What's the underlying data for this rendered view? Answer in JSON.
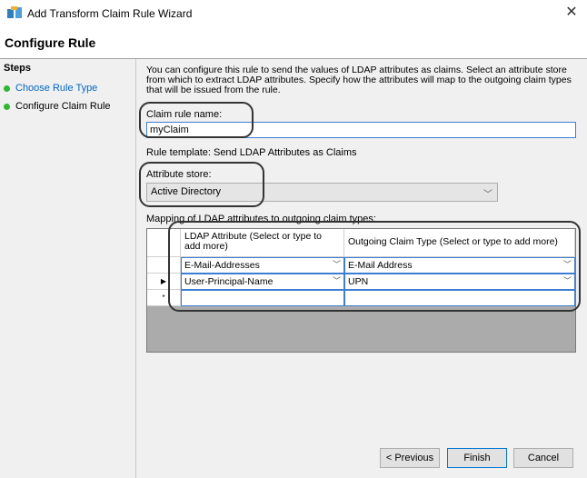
{
  "window": {
    "title": "Add Transform Claim Rule Wizard",
    "close_glyph": "✕"
  },
  "header": {
    "title": "Configure Rule"
  },
  "sidebar": {
    "heading": "Steps",
    "items": [
      {
        "label": "Choose Rule Type",
        "is_link": true
      },
      {
        "label": "Configure Claim Rule",
        "is_link": false
      }
    ]
  },
  "main": {
    "description": "You can configure this rule to send the values of LDAP attributes as claims. Select an attribute store from which to extract LDAP attributes. Specify how the attributes will map to the outgoing claim types that will be issued from the rule.",
    "claim_rule_name_label": "Claim rule name:",
    "claim_rule_name_value": "myClaim",
    "rule_template": "Rule template: Send LDAP Attributes as Claims",
    "attribute_store_label": "Attribute store:",
    "attribute_store_value": "Active Directory",
    "mapping_label": "Mapping of LDAP attributes to outgoing claim types:",
    "table": {
      "columns": [
        "LDAP Attribute (Select or type to add more)",
        "Outgoing Claim Type (Select or type to add more)"
      ],
      "rows": [
        {
          "marker": "",
          "ldap": "E-Mail-Addresses",
          "claim": "E-Mail Address"
        },
        {
          "marker": "▶",
          "ldap": "User-Principal-Name",
          "claim": "UPN"
        },
        {
          "marker": "*",
          "ldap": "",
          "claim": ""
        }
      ]
    }
  },
  "footer": {
    "previous": "< Previous",
    "finish": "Finish",
    "cancel": "Cancel"
  },
  "icons": {
    "chevron": "﹀",
    "app": "server-icon"
  },
  "colors": {
    "accent": "#0078d7",
    "link": "#0066cc",
    "step_dot": "#2eb82e"
  }
}
